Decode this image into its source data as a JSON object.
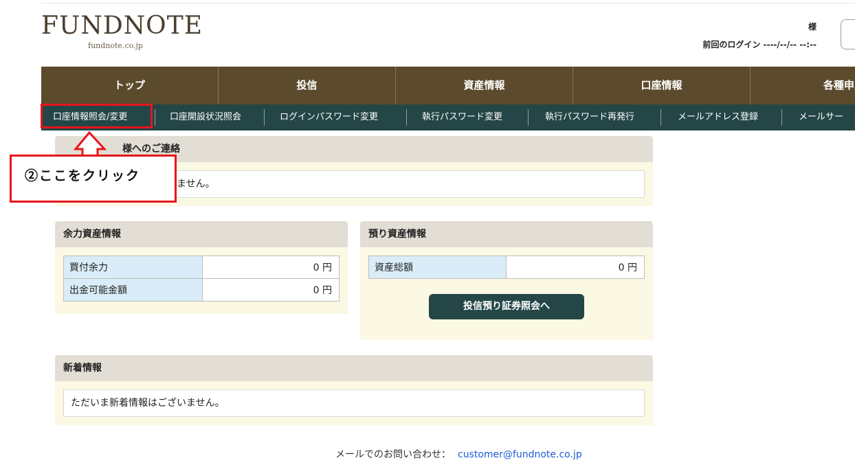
{
  "header": {
    "logo_brand": "FUNDNOTE",
    "logo_domain": "fundnote.co.jp",
    "user_suffix": "様",
    "last_login": "前回のログイン ----/--/-- --:--"
  },
  "main_nav": [
    "トップ",
    "投信",
    "資産情報",
    "口座情報",
    "各種申"
  ],
  "sub_nav": [
    "口座情報照会/変更",
    "口座開設状況照会",
    "ログインパスワード変更",
    "執行パスワード変更",
    "執行パスワード再発行",
    "メールアドレス登録",
    "メールサー"
  ],
  "notice": {
    "title": "様へのご連絡",
    "message": "ただいまご連絡はございません。"
  },
  "callout": {
    "text": "②ここをクリック",
    "color": "#e8141b"
  },
  "available_assets": {
    "title": "余力資産情報",
    "rows": [
      {
        "label": "買付余力",
        "value": "0 円"
      },
      {
        "label": "出金可能金額",
        "value": "0 円"
      }
    ]
  },
  "deposit_assets": {
    "title": "預り資産情報",
    "rows": [
      {
        "label": "資産総額",
        "value": "0 円"
      }
    ],
    "button": "投信預り証券照会へ"
  },
  "news": {
    "title": "新着情報",
    "message": "ただいま新着情報はございません。"
  },
  "footer": {
    "label": "メールでのお問い合わせ：",
    "email": "customer@fundnote.co.jp"
  },
  "colors": {
    "main_nav_bg": "#5c4a2c",
    "sub_nav_bg": "#244647",
    "panel_bg": "#fbf8e3",
    "highlight": "#e8141b"
  }
}
